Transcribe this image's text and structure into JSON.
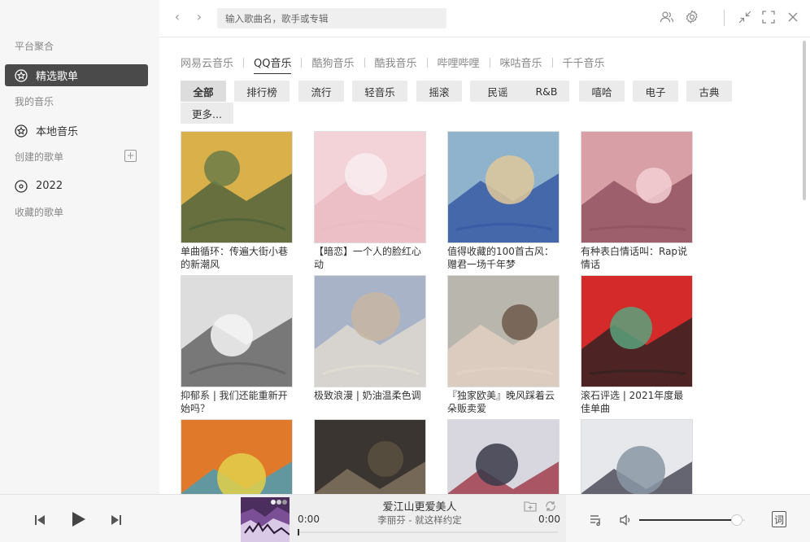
{
  "sidebar": {
    "sec_platform": "平台聚合",
    "featured": "精选歌单",
    "sec_my_music": "我的音乐",
    "local_music": "本地音乐",
    "sec_created": "创建的歌单",
    "created_add": "+",
    "playlist_2022": "2022",
    "sec_favorited": "收藏的歌单"
  },
  "topbar": {
    "back": "‹",
    "forward": "›",
    "search_placeholder": "输入歌曲名，歌手或专辑",
    "icons": [
      "user-icon",
      "gear-icon",
      "minimize-icon",
      "fullscreen-icon",
      "close-icon"
    ]
  },
  "source_tabs": [
    {
      "label": "网易云音乐",
      "active": false
    },
    {
      "label": "QQ音乐",
      "active": true
    },
    {
      "label": "酷狗音乐",
      "active": false
    },
    {
      "label": "酷我音乐",
      "active": false
    },
    {
      "label": "哔哩哔哩",
      "active": false
    },
    {
      "label": "咪咕音乐",
      "active": false
    },
    {
      "label": "千千音乐",
      "active": false
    }
  ],
  "categories": [
    {
      "label": "全部",
      "active": true
    },
    {
      "label": "排行榜"
    },
    {
      "label": "流行"
    },
    {
      "label": "轻音乐"
    },
    {
      "label": "摇滚"
    },
    {
      "label": "民谣"
    },
    {
      "label": "R&B"
    },
    {
      "label": "嘻哈"
    },
    {
      "label": "电子"
    },
    {
      "label": "古典"
    },
    {
      "label": "更多..."
    }
  ],
  "playlists": [
    {
      "title": "单曲循环：传遍大街小巷的新潮风"
    },
    {
      "title": "【暗恋】一个人的脸红心动"
    },
    {
      "title": "值得收藏的100首古风： 赠君一场千年梦"
    },
    {
      "title": "有种表白情话叫：Rap说情话"
    },
    {
      "title": "抑郁系 | 我们还能重新开始吗？"
    },
    {
      "title": "极致浪漫 | 奶油温柔色调"
    },
    {
      "title": "『独家欧美』晚风踩着云朵贩卖爱"
    },
    {
      "title": "滚石评选 | 2021年度最佳单曲"
    },
    {
      "title": ""
    },
    {
      "title": ""
    },
    {
      "title": ""
    },
    {
      "title": ""
    }
  ],
  "player": {
    "song": "爱江山更爱美人",
    "artist": "李丽芬 - 就这样约定",
    "time_current": "0:00",
    "time_total": "0:00",
    "progress": 0,
    "volume": 0.92,
    "lyrics_button": "词"
  },
  "colors": {
    "sidebar_bg": "#f6f6f6",
    "active_nav": "#4a4a4a",
    "accent": "#333333"
  }
}
